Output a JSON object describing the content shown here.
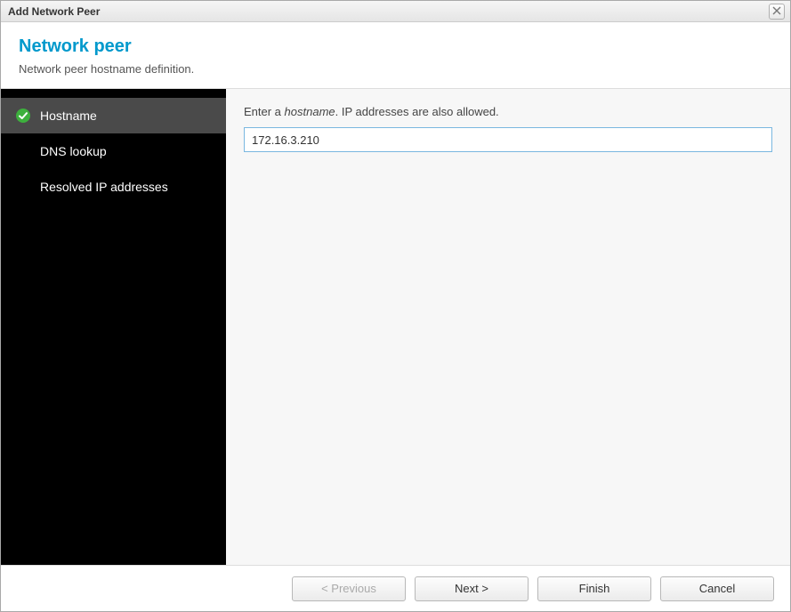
{
  "titlebar": {
    "title": "Add Network Peer"
  },
  "header": {
    "title": "Network peer",
    "subtitle": "Network peer hostname definition."
  },
  "sidebar": {
    "items": [
      {
        "label": "Hostname",
        "active": true,
        "hasCheck": true
      },
      {
        "label": "DNS lookup",
        "active": false,
        "hasCheck": false
      },
      {
        "label": "Resolved IP addresses",
        "active": false,
        "hasCheck": false
      }
    ]
  },
  "content": {
    "label_prefix": "Enter a ",
    "label_emphasis": "hostname",
    "label_suffix": ". IP addresses are also allowed.",
    "input_value": "172.16.3.210"
  },
  "footer": {
    "previous_label": "< Previous",
    "next_label": "Next >",
    "finish_label": "Finish",
    "cancel_label": "Cancel",
    "previous_disabled": true
  }
}
